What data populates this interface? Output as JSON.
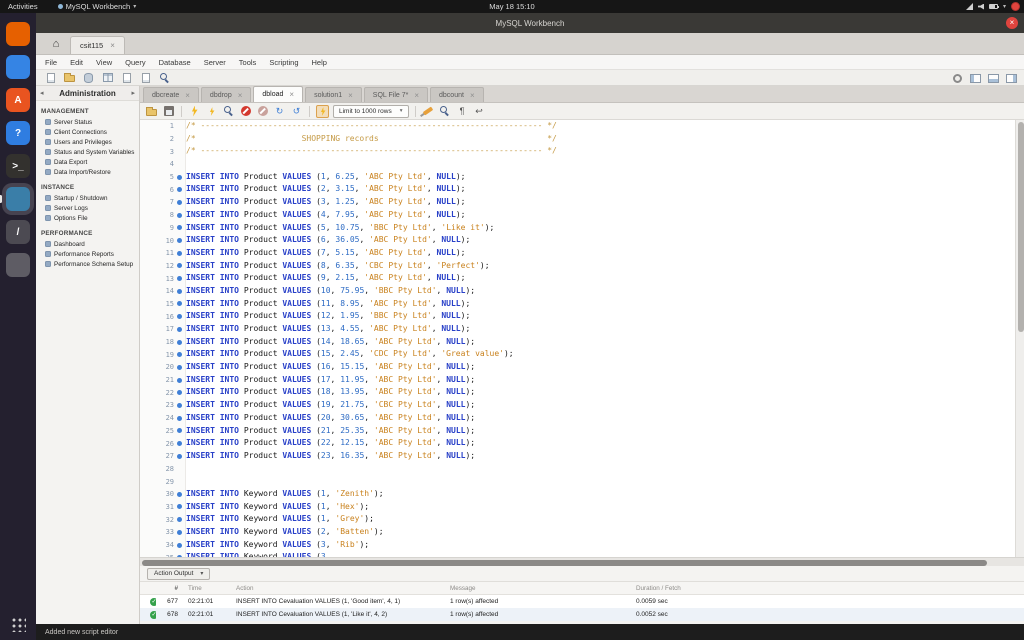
{
  "os_bar": {
    "activities": "Activities",
    "app_menu": "MySQL Workbench",
    "clock": "May 18 15:10"
  },
  "window": {
    "title": "MySQL Workbench"
  },
  "connection_tab": {
    "label": "csit115"
  },
  "menu": [
    "File",
    "Edit",
    "View",
    "Query",
    "Database",
    "Server",
    "Tools",
    "Scripting",
    "Help"
  ],
  "dock": [
    {
      "name": "firefox",
      "color": "#e66000",
      "glyph": ""
    },
    {
      "name": "file-manager",
      "color": "#3584e4",
      "glyph": ""
    },
    {
      "name": "ubuntu-software",
      "color": "#e95420",
      "glyph": "A"
    },
    {
      "name": "help",
      "color": "#2f7de1",
      "glyph": "?"
    },
    {
      "name": "terminal",
      "color": "#33312e",
      "glyph": ">_"
    },
    {
      "name": "mysql-workbench",
      "color": "#3a7ea8",
      "glyph": "",
      "active": true
    },
    {
      "name": "text-editor",
      "color": "#4c4a52",
      "glyph": "/"
    },
    {
      "name": "settings",
      "color": "#5e5c64",
      "glyph": ""
    }
  ],
  "sidebar": {
    "title": "Administration",
    "sections": [
      {
        "title": "MANAGEMENT",
        "items": [
          "Server Status",
          "Client Connections",
          "Users and Privileges",
          "Status and System Variables",
          "Data Export",
          "Data Import/Restore"
        ]
      },
      {
        "title": "INSTANCE",
        "items": [
          "Startup / Shutdown",
          "Server Logs",
          "Options File"
        ]
      },
      {
        "title": "PERFORMANCE",
        "items": [
          "Dashboard",
          "Performance Reports",
          "Performance Schema Setup"
        ]
      }
    ]
  },
  "main_toolbar": {
    "left": [
      "new-query-tab",
      "open-script",
      "create-schema",
      "create-table",
      "create-view",
      "create-procedure",
      "search-data"
    ],
    "right": [
      "preferences",
      "toggle-left-panel",
      "toggle-bottom-panel",
      "toggle-right-panel"
    ]
  },
  "editor_tabs": [
    {
      "label": "dbcreate",
      "active": false
    },
    {
      "label": "dbdrop",
      "active": false
    },
    {
      "label": "dbload",
      "active": true
    },
    {
      "label": "solution1",
      "active": false
    },
    {
      "label": "SQL File 7*",
      "active": false
    },
    {
      "label": "dbcount",
      "active": false
    }
  ],
  "sql_toolbar": {
    "left": [
      "open-file",
      "save-file"
    ],
    "exec": [
      "execute",
      "execute-current",
      "explain",
      "stop",
      "stop-on-error"
    ],
    "txn": [
      "commit",
      "rollback"
    ],
    "toggle": "limit-rows-toggle",
    "limit_label": "Limit to 1000 rows",
    "right": [
      "beautify",
      "find",
      "invisible-chars",
      "wrap-text"
    ]
  },
  "code": {
    "lines": [
      "/* ----------------------------------------------------------------------- */",
      "/*                      SHOPPING records                                   */",
      "/* ----------------------------------------------------------------------- */",
      "",
      "INSERT INTO Product VALUES (1, 6.25, 'ABC Pty Ltd', NULL);",
      "INSERT INTO Product VALUES (2, 3.15, 'ABC Pty Ltd', NULL);",
      "INSERT INTO Product VALUES (3, 1.25, 'ABC Pty Ltd', NULL);",
      "INSERT INTO Product VALUES (4, 7.95, 'ABC Pty Ltd', NULL);",
      "INSERT INTO Product VALUES (5, 10.75, 'BBC Pty Ltd', 'Like it');",
      "INSERT INTO Product VALUES (6, 36.05, 'ABC Pty Ltd', NULL);",
      "INSERT INTO Product VALUES (7, 5.15, 'ABC Pty Ltd', NULL);",
      "INSERT INTO Product VALUES (8, 6.35, 'CBC Pty Ltd', 'Perfect');",
      "INSERT INTO Product VALUES (9, 2.15, 'ABC Pty Ltd', NULL);",
      "INSERT INTO Product VALUES (10, 75.95, 'BBC Pty Ltd', NULL);",
      "INSERT INTO Product VALUES (11, 8.95, 'ABC Pty Ltd', NULL);",
      "INSERT INTO Product VALUES (12, 1.95, 'BBC Pty Ltd', NULL);",
      "INSERT INTO Product VALUES (13, 4.55, 'ABC Pty Ltd', NULL);",
      "INSERT INTO Product VALUES (14, 18.65, 'ABC Pty Ltd', NULL);",
      "INSERT INTO Product VALUES (15, 2.45, 'CDC Pty Ltd', 'Great value');",
      "INSERT INTO Product VALUES (16, 15.15, 'ABC Pty Ltd', NULL);",
      "INSERT INTO Product VALUES (17, 11.95, 'ABC Pty Ltd', NULL);",
      "INSERT INTO Product VALUES (18, 13.95, 'ABC Pty Ltd', NULL);",
      "INSERT INTO Product VALUES (19, 21.75, 'CBC Pty Ltd', NULL);",
      "INSERT INTO Product VALUES (20, 30.65, 'ABC Pty Ltd', NULL);",
      "INSERT INTO Product VALUES (21, 25.35, 'ABC Pty Ltd', NULL);",
      "INSERT INTO Product VALUES (22, 12.15, 'ABC Pty Ltd', NULL);",
      "INSERT INTO Product VALUES (23, 16.35, 'ABC Pty Ltd', NULL);",
      "",
      "",
      "INSERT INTO Keyword VALUES (1, 'Zenith');",
      "INSERT INTO Keyword VALUES (1, 'Hex');",
      "INSERT INTO Keyword VALUES (1, 'Grey');",
      "INSERT INTO Keyword VALUES (2, 'Batten');",
      "INSERT INTO Keyword VALUES (3, 'Rib');",
      "INSERT INTO Keyword VALUES (3,"
    ]
  },
  "output": {
    "dropdown_label": "Action Output",
    "columns": [
      "#",
      "Time",
      "Action",
      "Message",
      "Duration / Fetch"
    ],
    "rows": [
      {
        "index": "677",
        "time": "02:21:01",
        "action": "INSERT INTO Cevaluation VALUES (1, 'Good item', 4, 1)",
        "message": "1 row(s) affected",
        "duration": "0.0059 sec"
      },
      {
        "index": "678",
        "time": "02:21:01",
        "action": "INSERT INTO Cevaluation VALUES (1, 'Like it', 4, 2)",
        "message": "1 row(s) affected",
        "duration": "0.0052 sec"
      }
    ]
  },
  "status_bar": {
    "message": "Added new script editor"
  },
  "colors": {
    "keyword": "#2840c8",
    "number": "#2d6bc4",
    "string": "#c9821e",
    "comment": "#c59a45",
    "accent_blue": "#3f7fd6",
    "success_green": "#35a14b",
    "close_red": "#e0443e"
  }
}
